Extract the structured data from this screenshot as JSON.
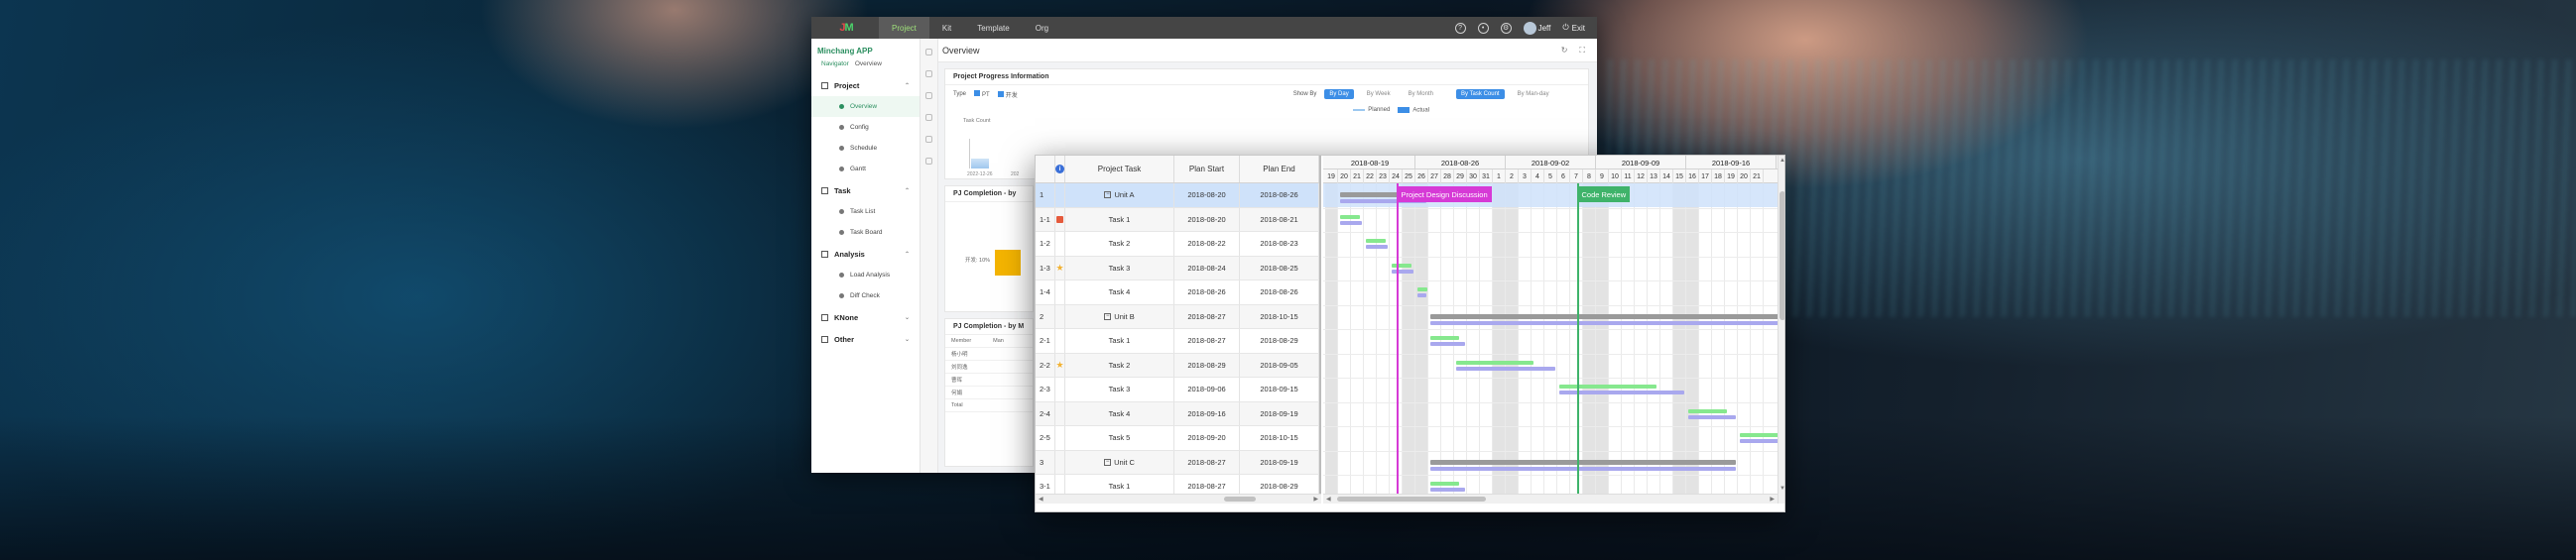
{
  "colors": {
    "accent_green": "#2c8f60",
    "topbar": "#454545",
    "active_nav": "#9fe07a",
    "plan_bar": "#a9a8ee",
    "actual_bar": "#86e88e",
    "summary_bar": "#9a9a9a",
    "milestone_magenta": "#d63ad6",
    "milestone_green": "#3fb36a",
    "selection": "#cfe2fa",
    "chart_blue": "#3c8ee6",
    "chart_yellow": "#f4b400"
  },
  "back": {
    "logo": {
      "main": "J",
      "accent": "M"
    },
    "topnav": [
      "Project",
      "Kit",
      "Template",
      "Org"
    ],
    "user": "Jeff",
    "exit": "Exit",
    "app_title": "Minchang APP",
    "side_tabs": [
      "Navigator",
      "Overview"
    ],
    "groups": {
      "project": {
        "label": "Project",
        "items": [
          "Overview",
          "Config",
          "Schedule",
          "Gantt"
        ]
      },
      "task": {
        "label": "Task",
        "items": [
          "Task List",
          "Task Board"
        ]
      },
      "analysis": {
        "label": "Analysis",
        "items": [
          "Load Analysis",
          "Diff Check"
        ]
      },
      "know": {
        "label": "KNone"
      },
      "other": {
        "label": "Other"
      }
    },
    "main_title": "Overview",
    "card1": {
      "title": "Project Progress Information",
      "type_label": "Type",
      "type_opts": [
        "PT",
        "开发"
      ],
      "show_label": "Show By",
      "show_opts": [
        "By Day",
        "By Week",
        "By Month"
      ],
      "count_opts": [
        "By Task Count",
        "By Man-day"
      ],
      "legend_planned": "Planned",
      "legend_actual": "Actual",
      "y_label": "Task Count",
      "x_tick": "2022-12-26",
      "x_tick2": "202"
    },
    "card2": {
      "title": "PJ Completion - by",
      "bar_label": "开发: 10%"
    },
    "card3": {
      "title": "PJ Completion - by M",
      "col1": "Member",
      "col2": "Man",
      "rows": [
        "杨小明",
        "刘同逸",
        "曹晖",
        "何娟",
        "Total"
      ]
    }
  },
  "gantt": {
    "columns": {
      "no": "",
      "task": "Project Task",
      "start": "Plan Start",
      "end": "Plan End"
    },
    "rows": [
      {
        "no": "1",
        "icon": "",
        "toggle": "⊟",
        "task": "Unit A",
        "start": "2018-08-20",
        "end": "2018-08-26"
      },
      {
        "no": "1-1",
        "icon": "flag",
        "toggle": "",
        "task": "Task 1",
        "start": "2018-08-20",
        "end": "2018-08-21"
      },
      {
        "no": "1-2",
        "icon": "",
        "toggle": "",
        "task": "Task 2",
        "start": "2018-08-22",
        "end": "2018-08-23"
      },
      {
        "no": "1-3",
        "icon": "star",
        "toggle": "",
        "task": "Task 3",
        "start": "2018-08-24",
        "end": "2018-08-25"
      },
      {
        "no": "1-4",
        "icon": "",
        "toggle": "",
        "task": "Task 4",
        "start": "2018-08-26",
        "end": "2018-08-26"
      },
      {
        "no": "2",
        "icon": "",
        "toggle": "⊟",
        "task": "Unit B",
        "start": "2018-08-27",
        "end": "2018-10-15"
      },
      {
        "no": "2-1",
        "icon": "",
        "toggle": "",
        "task": "Task 1",
        "start": "2018-08-27",
        "end": "2018-08-29"
      },
      {
        "no": "2-2",
        "icon": "star",
        "toggle": "",
        "task": "Task 2",
        "start": "2018-08-29",
        "end": "2018-09-05"
      },
      {
        "no": "2-3",
        "icon": "",
        "toggle": "",
        "task": "Task 3",
        "start": "2018-09-06",
        "end": "2018-09-15"
      },
      {
        "no": "2-4",
        "icon": "",
        "toggle": "",
        "task": "Task 4",
        "start": "2018-09-16",
        "end": "2018-09-19"
      },
      {
        "no": "2-5",
        "icon": "",
        "toggle": "",
        "task": "Task 5",
        "start": "2018-09-20",
        "end": "2018-10-15"
      },
      {
        "no": "3",
        "icon": "",
        "toggle": "⊟",
        "task": "Unit C",
        "start": "2018-08-27",
        "end": "2018-09-19"
      },
      {
        "no": "3-1",
        "icon": "",
        "toggle": "",
        "task": "Task 1",
        "start": "2018-08-27",
        "end": "2018-08-29"
      }
    ],
    "weeks": [
      "2018-08-19",
      "2018-08-26",
      "2018-09-02",
      "2018-09-09",
      "2018-09-16"
    ],
    "days": [
      "19",
      "20",
      "21",
      "22",
      "23",
      "24",
      "25",
      "26",
      "27",
      "28",
      "29",
      "30",
      "31",
      "1",
      "2",
      "3",
      "4",
      "5",
      "6",
      "7",
      "8",
      "9",
      "10",
      "11",
      "12",
      "13",
      "14",
      "15",
      "16",
      "17",
      "18",
      "19",
      "20",
      "21"
    ],
    "milestones": [
      {
        "label": "Project Design Discussion",
        "date": "2018-08-24"
      },
      {
        "label": "Code Review",
        "date": "2018-09-07"
      }
    ]
  }
}
